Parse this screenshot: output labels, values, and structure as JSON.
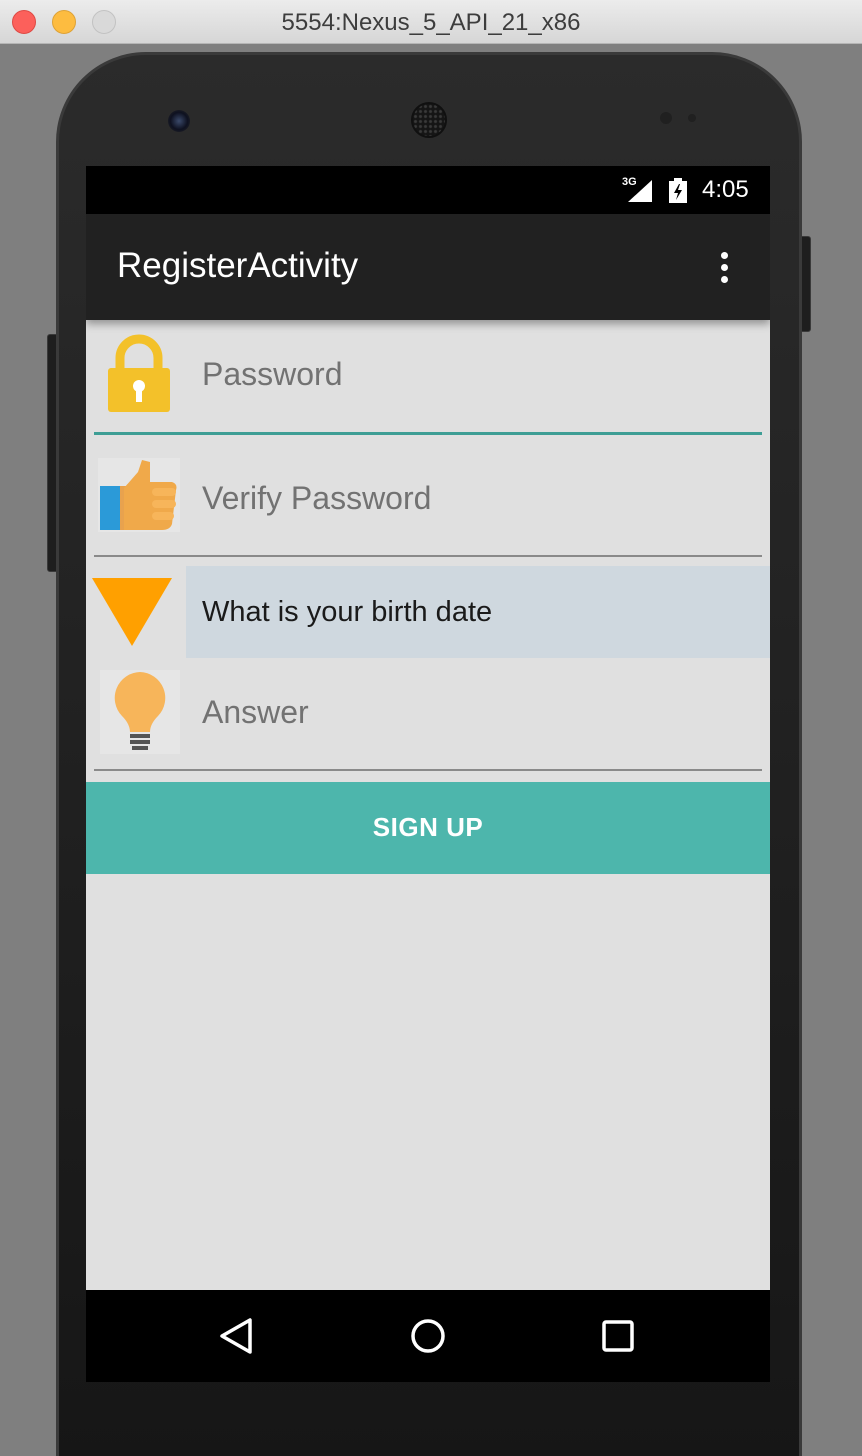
{
  "window": {
    "title": "5554:Nexus_5_API_21_x86"
  },
  "status_bar": {
    "network": "3G",
    "time": "4:05"
  },
  "action_bar": {
    "title": "RegisterActivity",
    "overflow_icon": "more-vert-icon"
  },
  "form": {
    "password_placeholder": "Password",
    "verify_password_placeholder": "Verify Password",
    "security_question_selected": "What is your birth date",
    "answer_placeholder": "Answer",
    "signup_label": "SIGN UP"
  },
  "icons": {
    "password": "lock-icon",
    "verify": "thumbs-up-icon",
    "question": "dropdown-triangle-icon",
    "answer": "lightbulb-icon"
  },
  "colors": {
    "accent": "#4db6ac",
    "action_bar": "#212121",
    "spinner_bg": "#cfd8df",
    "icon_yellow": "#f3c12a",
    "icon_orange": "#ffa000"
  }
}
